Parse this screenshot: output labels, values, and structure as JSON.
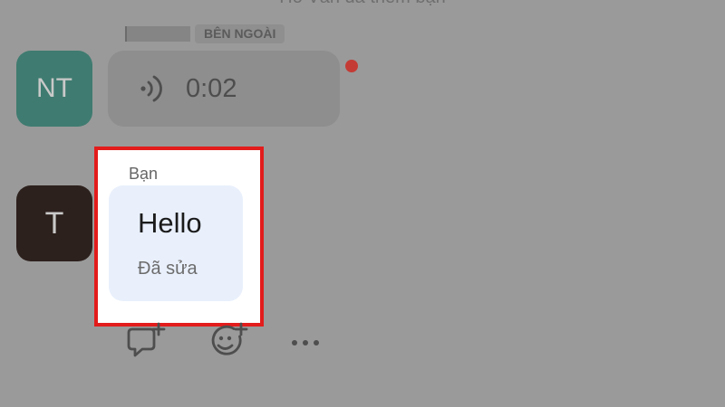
{
  "header": {
    "text_cut": "Hồ Văn đã thêm bạn"
  },
  "conversation": {
    "incoming": {
      "avatar_initials": "NT",
      "badge": "BÊN NGOÀI",
      "voice_duration": "0:02",
      "unread_dot_color": "#c43b35"
    },
    "outgoing": {
      "avatar_initial": "T",
      "sender_label": "Bạn",
      "message": "Hello",
      "edited_label": "Đã sửa"
    }
  },
  "actions": [
    {
      "icon": "reply-add-icon"
    },
    {
      "icon": "emoji-add-icon"
    },
    {
      "icon": "more-icon"
    }
  ],
  "colors": {
    "highlight_border": "#e31c1c",
    "my_bubble": "#e9f0fc"
  }
}
